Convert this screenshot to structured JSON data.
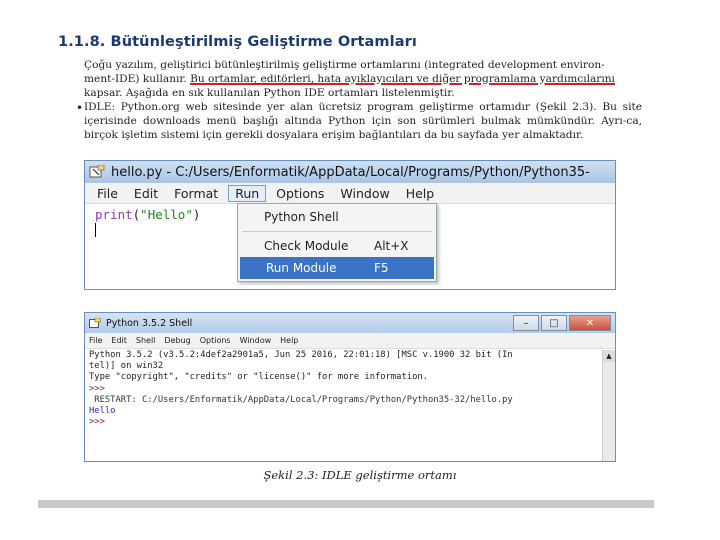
{
  "heading": "1.1.8. Bütünleştirilmiş Geliştirme Ortamları",
  "paragraph": {
    "line1_pre": "Çoğu yazılım, geliştirici bütünleştirilmiş geliştirme ortamlarını (integrated development environ-",
    "line2_pre": "ment-IDE) kullanır. ",
    "line2_hl": "Bu ortamlar, editörleri, hata ayıklayıcıları ve diğer programlama yardımcılarını",
    "line3": "kapsar. Aşağıda en sık kullanılan Python IDE ortamları listelenmiştir."
  },
  "bullet": {
    "symbol": "•",
    "text": "IDLE: Python.org web sitesinde yer alan ücretsiz program geliştirme ortamıdır (Şekil 2.3). Bu site içerisinde downloads menü başlığı altında Python için son sürümleri bulmak mümkündür. Ayrı-ca, birçok işletim sistemi için gerekli dosyalara erişim bağlantıları da bu sayfada yer almaktadır."
  },
  "editor": {
    "title": "hello.py - C:/Users/Enformatik/AppData/Local/Programs/Python/Python35-",
    "menu": [
      "File",
      "Edit",
      "Format",
      "Run",
      "Options",
      "Window",
      "Help"
    ],
    "code_kw": "print",
    "code_paren_open": "(",
    "code_str": "\"Hello\"",
    "code_paren_close": ")",
    "dropdown": {
      "python_shell": "Python Shell",
      "check_module": "Check Module",
      "check_accel": "Alt+X",
      "run_module": "Run Module",
      "run_accel": "F5"
    }
  },
  "shell": {
    "title": "Python 3.5.2 Shell",
    "menu": [
      "File",
      "Edit",
      "Shell",
      "Debug",
      "Options",
      "Window",
      "Help"
    ],
    "lines": [
      "Python 3.5.2 (v3.5.2:4def2a2901a5, Jun 25 2016, 22:01:18) [MSC v.1900 32 bit (In",
      "tel)] on win32",
      "Type \"copyright\", \"credits\" or \"license()\" for more information.",
      ">>> ",
      " RESTART: C:/Users/Enformatik/AppData/Local/Programs/Python/Python35-32/hello.py",
      "",
      "Hello",
      ">>> "
    ]
  },
  "caption": "Şekil 2.3: IDLE geliştirme ortamı",
  "colors": {
    "heading": "#1b3a73",
    "highlight_underline": "#d02020",
    "menu_selected": "#3b74c6"
  }
}
